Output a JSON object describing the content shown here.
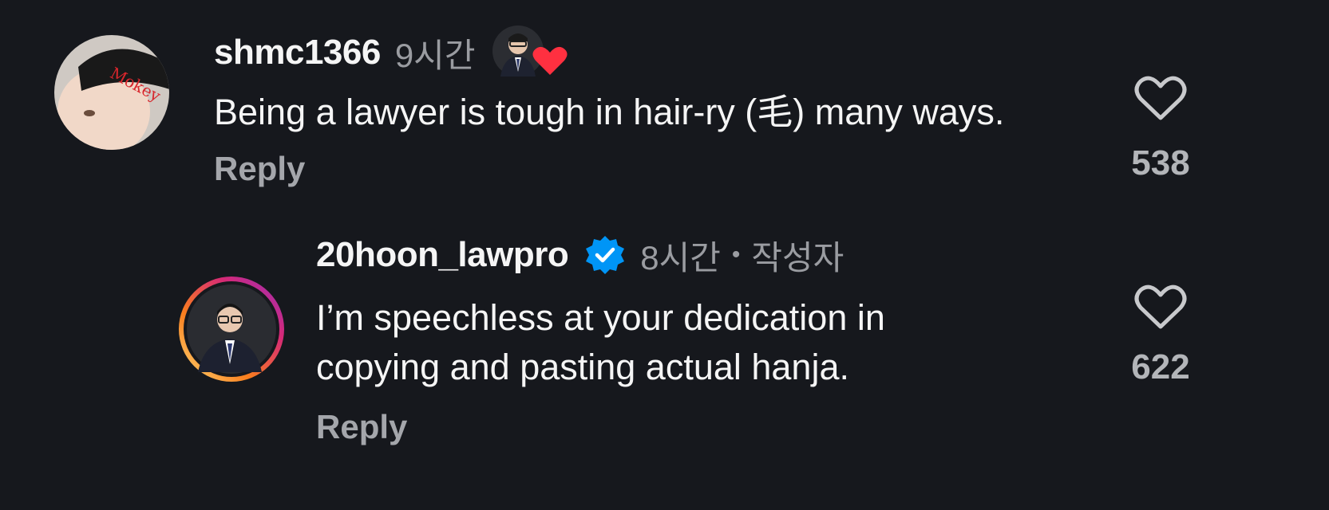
{
  "comments": [
    {
      "username": "shmc1366",
      "time": "9시간",
      "text": "Being a lawyer is tough in hair-ry (毛) many ways.",
      "reply_label": "Reply",
      "like_count": "538",
      "avatar_cap_text": "Mokey"
    },
    {
      "username": "20hoon_lawpro",
      "time": "8시간",
      "separator": "•",
      "author_label": "작성자",
      "text_lines": [
        "I’m speechless at your dedication in",
        "copying and pasting actual hanja."
      ],
      "reply_label": "Reply",
      "like_count": "622"
    }
  ],
  "colors": {
    "background": "#16181d",
    "heart_liked": "#ff3040",
    "verified_blue": "#0095f6",
    "story_ring": [
      "#feda75",
      "#fa7e1e",
      "#d62976",
      "#962fbf"
    ]
  }
}
